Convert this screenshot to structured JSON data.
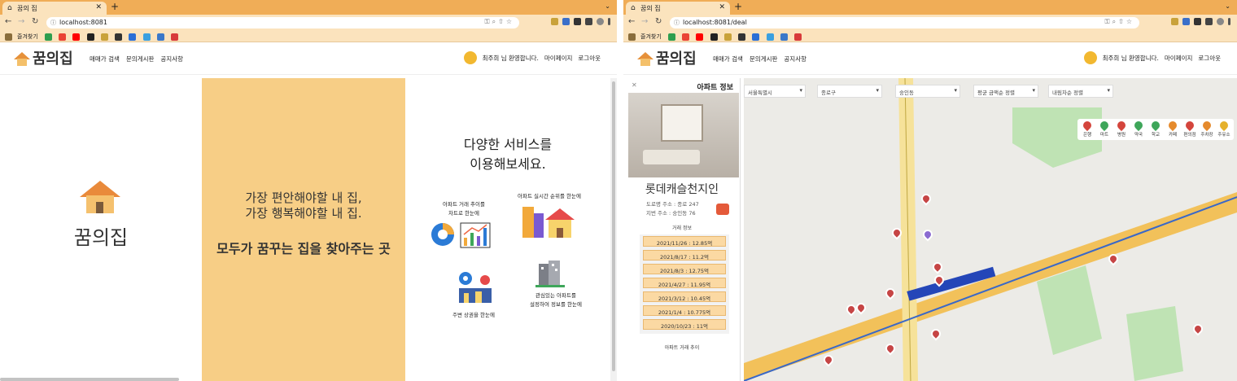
{
  "left": {
    "tab_title": "꿈의 집",
    "url": "localhost:8081",
    "bookmarks_label": "즐겨찾기",
    "logo_text": "꿈의집",
    "menu": [
      "매매가 검색",
      "문의게시판",
      "공지사항"
    ],
    "user_greeting": "최주희 님 환영합니다.",
    "mypage": "마이페이지",
    "logout": "로그아웃",
    "brand_big": "꿈의집",
    "slogan_line1": "가장 편안해야할 내 집,",
    "slogan_line2": "가장 행복해야할 내 집.",
    "slogan_main": "모두가 꿈꾸는 집을 찾아주는 곳",
    "services_title1": "다양한 서비스를",
    "services_title2": "이용해보세요.",
    "services": [
      {
        "caption1": "아파트 거래 추이를",
        "caption2": "차트로 한눈에",
        "icon": "chart-icon"
      },
      {
        "caption1": "아파트 실시간 순위를 한눈에",
        "caption2": "",
        "icon": "town-icon"
      },
      {
        "caption1": "주변 상권을 한눈에",
        "caption2": "",
        "icon": "map-pin-icon"
      },
      {
        "caption1": "관심있는 아파트를",
        "caption2": "설정하여 정보를 한눈에",
        "icon": "building-icon"
      }
    ]
  },
  "right": {
    "tab_title": "꿈의 집",
    "url": "localhost:8081/deal",
    "bookmarks_label": "즐겨찾기",
    "logo_text": "꿈의집",
    "menu": [
      "매매가 검색",
      "문의게시판",
      "공지사항"
    ],
    "user_greeting": "최주희 님 환영합니다.",
    "mypage": "마이페이지",
    "logout": "로그아웃",
    "filters": [
      "서울특별시",
      "종로구",
      "숭인동",
      "평균 금액순 정렬",
      "내림차순 정렬"
    ],
    "categories": [
      {
        "label": "은행",
        "color": "#d4453c"
      },
      {
        "label": "마트",
        "color": "#3ea65a"
      },
      {
        "label": "병원",
        "color": "#d4453c"
      },
      {
        "label": "약국",
        "color": "#3ea65a"
      },
      {
        "label": "학교",
        "color": "#3ea65a"
      },
      {
        "label": "카페",
        "color": "#e58a2c"
      },
      {
        "label": "편의점",
        "color": "#d4453c"
      },
      {
        "label": "주차장",
        "color": "#e58a2c"
      },
      {
        "label": "주유소",
        "color": "#e5b12c"
      }
    ],
    "panel_title": "아파트 정보",
    "apt_name": "롯데캐슬천지인",
    "road_addr": "도로명 주소 : 종로 247",
    "jibun_addr": "지번 주소 : 숭인동 76",
    "trade_header": "거래 정보",
    "deals": [
      "2021/11/26 : 12.85억",
      "2021/8/17 : 11.2억",
      "2021/8/3 : 12.75억",
      "2021/4/27 : 11.95억",
      "2021/3/12 : 10.45억",
      "2021/1/4 : 10.775억",
      "2020/10/23 : 11억"
    ],
    "trend_title": "아파트 거래 추이"
  }
}
